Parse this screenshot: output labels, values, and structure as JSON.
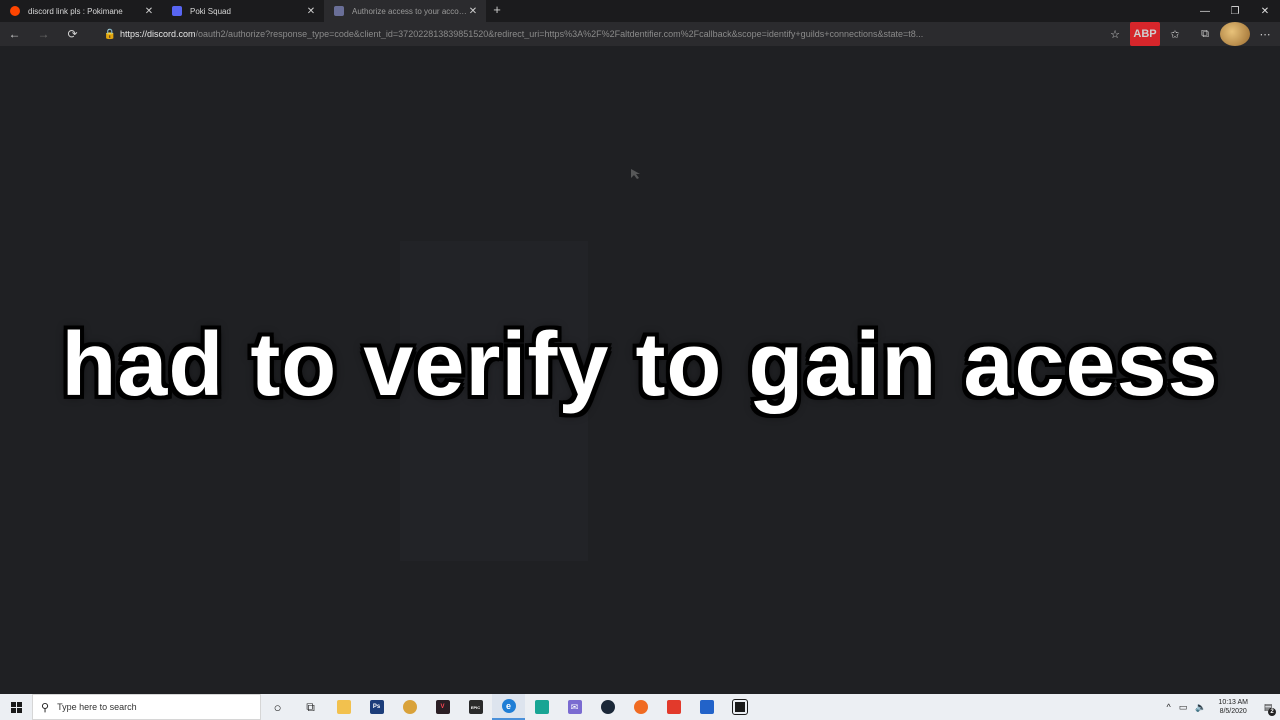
{
  "browser": {
    "tabs": [
      {
        "title": "discord link pls : Pokimane",
        "favicon": "reddit-icon",
        "active": false
      },
      {
        "title": "Poki Squad",
        "favicon": "discord-icon",
        "active": false
      },
      {
        "title": "Authorize access to your account",
        "favicon": "discord-icon",
        "active": true
      }
    ],
    "tab_close_glyph": "✕",
    "new_tab_glyph": "+",
    "window_controls": {
      "minimize": "—",
      "restore": "❐",
      "close": "✕"
    },
    "address": {
      "host": "https://discord.com",
      "path": "/oauth2/authorize?response_type=code&client_id=372022813839851520&redirect_uri=https%3A%2F%2Faltdentifier.com%2Fcallback&scope=identify+guilds+connections&state=t8..."
    },
    "nav": {
      "back": "←",
      "forward": "→",
      "refresh": "⟳"
    }
  },
  "page": {
    "caption": "had to verify to gain acess",
    "background": "#1f2023"
  },
  "taskbar": {
    "search_placeholder": "Type here to search",
    "apps": [
      {
        "name": "cortana-icon",
        "glyph": "○"
      },
      {
        "name": "task-view-icon",
        "glyph": "⧉"
      },
      {
        "name": "file-explorer-icon",
        "glyph": "▬",
        "color": "#f2c14e"
      },
      {
        "name": "photoshop-icon",
        "glyph": "Ps",
        "color": "#1c3d7a"
      },
      {
        "name": "chrome-icon",
        "glyph": "◉",
        "color": "#d9a23a"
      },
      {
        "name": "valorant-icon",
        "glyph": "V",
        "color": "#2a1e24"
      },
      {
        "name": "epic-games-icon",
        "glyph": "EPIC",
        "color": "#2a2a2a"
      },
      {
        "name": "edge-icon",
        "glyph": "e",
        "color": "#1f7ed6",
        "active": true
      },
      {
        "name": "discord-app-icon",
        "glyph": "◧",
        "color": "#18a594"
      },
      {
        "name": "mail-icon",
        "glyph": "✉",
        "color": "#7a6bd1"
      },
      {
        "name": "steam-icon",
        "glyph": "♨",
        "color": "#1b2838"
      },
      {
        "name": "origin-icon",
        "glyph": "◎",
        "color": "#f06b22"
      },
      {
        "name": "roblox-icon",
        "glyph": "◆",
        "color": "#e23a2b"
      },
      {
        "name": "visual-studio-icon",
        "glyph": "◣",
        "color": "#2263c9"
      },
      {
        "name": "terminal-icon",
        "glyph": "▣",
        "color": "#1a1a1a"
      }
    ],
    "tray": {
      "chevron": "^",
      "network": "▭",
      "volume": "🔈"
    },
    "clock": {
      "time": "10:13 AM",
      "date": "8/5/2020"
    },
    "notifications": {
      "glyph": "▤",
      "count": "2"
    }
  }
}
